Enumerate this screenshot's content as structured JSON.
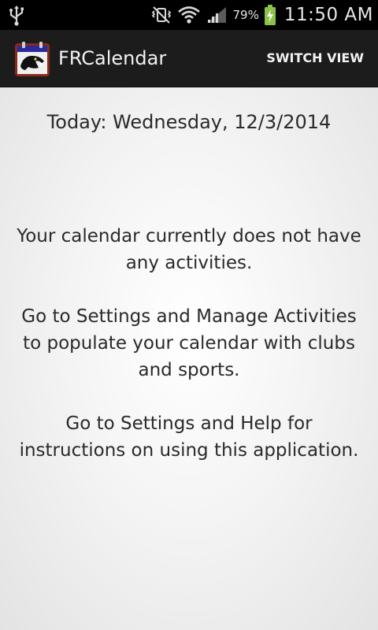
{
  "status_bar": {
    "battery_percent": "79%",
    "time": "11:50 AM",
    "icons": [
      "usb-icon",
      "mute-vibrate-icon",
      "wifi-icon",
      "signal-icon",
      "battery-charging-icon"
    ]
  },
  "action_bar": {
    "title": "FRCalendar",
    "switch_view_label": "SWITCH VIEW",
    "app_icon": "panther-calendar-icon"
  },
  "main": {
    "today": "Today: Wednesday, 12/3/2014",
    "message_lines": [
      "Your calendar currently does not have any activities.",
      "Go to Settings and Manage Activities to populate your calendar with clubs and sports.",
      "Go to Settings and Help for instructions on using this application."
    ]
  },
  "colors": {
    "status_bar_bg": "#000000",
    "action_bar_bg": "#1c1c1c",
    "battery_green": "#8bc34a",
    "text_dark": "#2a2a2a"
  }
}
